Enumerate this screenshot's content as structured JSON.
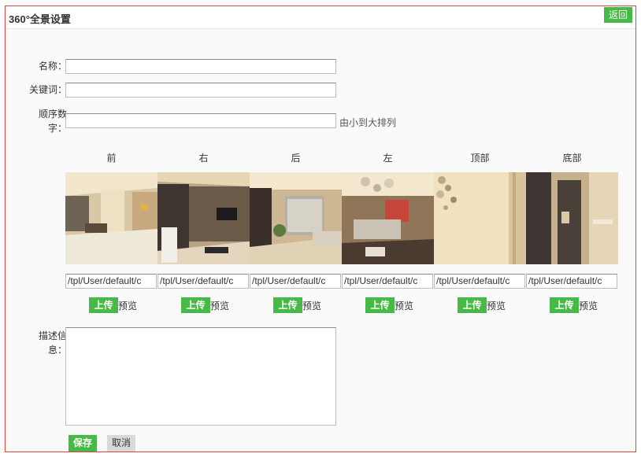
{
  "header": {
    "title": "360°全景设置",
    "back_label": "返回"
  },
  "form": {
    "name_label": "名称：",
    "name_value": "",
    "keyword_label": "关键词：",
    "keyword_value": "",
    "order_label_line1": "顺序数",
    "order_label_line2": "字：",
    "order_value": "",
    "order_hint": "由小到大排列",
    "desc_label_line1": "描述信",
    "desc_label_line2": "息：",
    "desc_value": ""
  },
  "panorama": {
    "faces": [
      {
        "label": "前",
        "path": "/tpl/User/default/c",
        "upload": "上传",
        "preview": "预览"
      },
      {
        "label": "右",
        "path": "/tpl/User/default/c",
        "upload": "上传",
        "preview": "预览"
      },
      {
        "label": "后",
        "path": "/tpl/User/default/c",
        "upload": "上传",
        "preview": "预览"
      },
      {
        "label": "左",
        "path": "/tpl/User/default/c",
        "upload": "上传",
        "preview": "预览"
      },
      {
        "label": "顶部",
        "path": "/tpl/User/default/c",
        "upload": "上传",
        "preview": "预览"
      },
      {
        "label": "底部",
        "path": "/tpl/User/default/c",
        "upload": "上传",
        "preview": "预览"
      }
    ]
  },
  "actions": {
    "save": "保存",
    "cancel": "取消"
  },
  "colors": {
    "accent": "#46b946",
    "frame_border": "#e0443a"
  }
}
